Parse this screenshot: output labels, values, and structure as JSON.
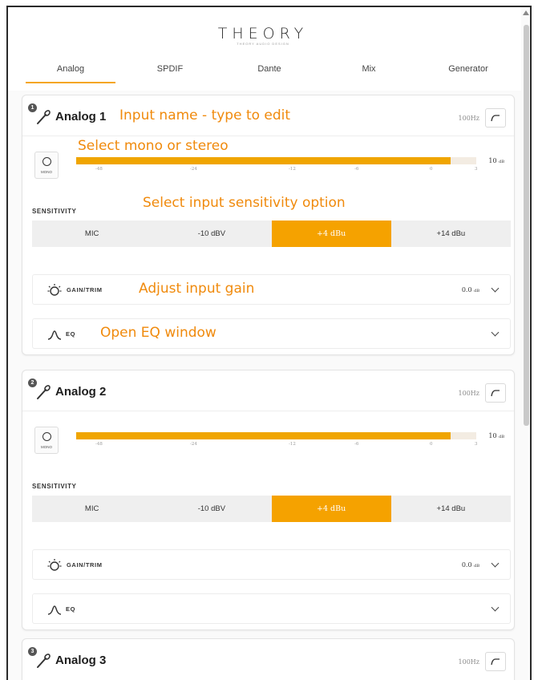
{
  "header": {
    "logo": "THEORY",
    "logo_sub": "THEORY AUDIO DESIGN",
    "tabs": [
      {
        "label": "Analog",
        "active": true
      },
      {
        "label": "SPDIF",
        "active": false
      },
      {
        "label": "Dante",
        "active": false
      },
      {
        "label": "Mix",
        "active": false
      },
      {
        "label": "Generator",
        "active": false
      }
    ]
  },
  "accent_color": "#f5a200",
  "annotation_color": "#f08a0c",
  "annotations": {
    "name": "Input name - type to edit",
    "mono": "Select mono or stereo",
    "sensitivity": "Select input sensitivity option",
    "gain": "Adjust input gain",
    "eq": "Open EQ window"
  },
  "channels": [
    {
      "number": "1",
      "name": "Analog 1",
      "hpf": "100Hz",
      "mono_label": "MONO",
      "meter_level": "10",
      "meter_unit": "dB",
      "meter_fill_fraction": 0.935,
      "meter_peak_fraction": 0.922,
      "scale": [
        "-48",
        "-24",
        "-12",
        "-6",
        "0",
        "3"
      ],
      "sensitivity_label": "SENSITIVITY",
      "sensitivity_options": [
        "MIC",
        "-10 dBV",
        "+4 dBu",
        "+14 dBu"
      ],
      "sensitivity_selected": "+4 dBu",
      "gain_label": "GAIN/TRIM",
      "gain_value": "0.0",
      "gain_unit": "dB",
      "eq_label": "EQ"
    },
    {
      "number": "2",
      "name": "Analog 2",
      "hpf": "100Hz",
      "mono_label": "MONO",
      "meter_level": "10",
      "meter_unit": "dB",
      "meter_fill_fraction": 0.935,
      "meter_peak_fraction": 0.922,
      "scale": [
        "-48",
        "-24",
        "-12",
        "-6",
        "0",
        "3"
      ],
      "sensitivity_label": "SENSITIVITY",
      "sensitivity_options": [
        "MIC",
        "-10 dBV",
        "+4 dBu",
        "+14 dBu"
      ],
      "sensitivity_selected": "+4 dBu",
      "gain_label": "GAIN/TRIM",
      "gain_value": "0.0",
      "gain_unit": "dB",
      "eq_label": "EQ"
    },
    {
      "number": "3",
      "name": "Analog 3",
      "hpf": "100Hz"
    }
  ]
}
